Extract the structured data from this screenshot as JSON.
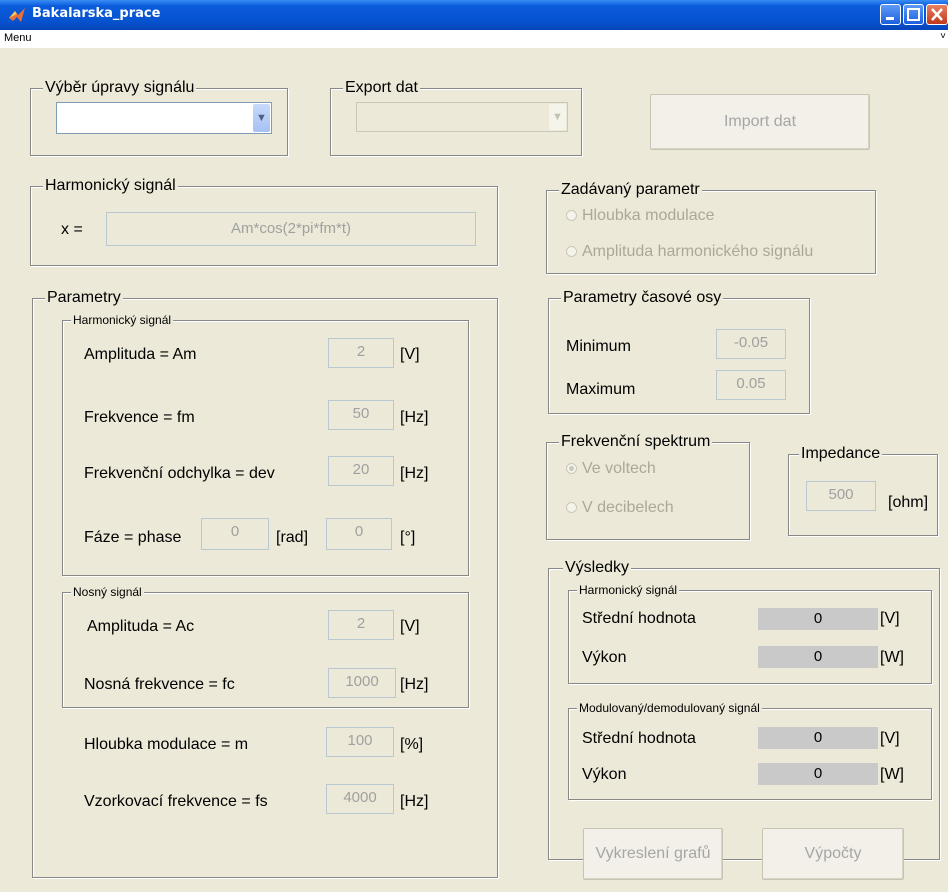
{
  "window": {
    "title": "Bakalarska_prace"
  },
  "menu": {
    "items": [
      "Menu"
    ]
  },
  "signal_select": {
    "title": "Výběr úpravy signálu",
    "value": ""
  },
  "export": {
    "title": "Export dat",
    "value": ""
  },
  "import_button": "Import dat",
  "harmonic_signal": {
    "title": "Harmonický signál",
    "x_label": "x =",
    "expression": "Am*cos(2*pi*fm*t)"
  },
  "param_select": {
    "title": "Zadávaný parametr",
    "options": [
      "Hloubka modulace",
      "Amplituda harmonického signálu"
    ]
  },
  "parametry": {
    "title": "Parametry",
    "harmonic": {
      "title": "Harmonický signál",
      "amplitude": {
        "label": "Amplituda = Am",
        "value": "2",
        "unit": "[V]"
      },
      "frequency": {
        "label": "Frekvence = fm",
        "value": "50",
        "unit": "[Hz]"
      },
      "deviation": {
        "label": "Frekvenční odchylka = dev",
        "value": "20",
        "unit": "[Hz]"
      },
      "phase": {
        "label": "Fáze = phase",
        "rad_value": "0",
        "rad_unit": "[rad]",
        "deg_value": "0",
        "deg_unit": "[°]"
      }
    },
    "carrier": {
      "title": "Nosný signál",
      "amplitude": {
        "label": "Amplituda = Ac",
        "value": "2",
        "unit": "[V]"
      },
      "frequency": {
        "label": "Nosná frekvence = fc",
        "value": "1000",
        "unit": "[Hz]"
      }
    },
    "modulation_depth": {
      "label": "Hloubka modulace = m",
      "value": "100",
      "unit": "[%]"
    },
    "sampling": {
      "label": "Vzorkovací frekvence = fs",
      "value": "4000",
      "unit": "[Hz]"
    }
  },
  "time_axis": {
    "title": "Parametry časové osy",
    "min_label": "Minimum",
    "min_value": "-0.05",
    "max_label": "Maximum",
    "max_value": "0.05"
  },
  "spectrum": {
    "title": "Frekvenční spektrum",
    "options": [
      "Ve voltech",
      "V decibelech"
    ],
    "selected": 0
  },
  "impedance": {
    "title": "Impedance",
    "value": "500",
    "unit": "[ohm]"
  },
  "results": {
    "title": "Výsledky",
    "harmonic": {
      "title": "Harmonický signál",
      "mean_label": "Střední hodnota",
      "mean_value": "0",
      "mean_unit": "[V]",
      "power_label": "Výkon",
      "power_value": "0",
      "power_unit": "[W]"
    },
    "modulated": {
      "title": "Modulovaný/demodulovaný signál",
      "mean_label": "Střední hodnota",
      "mean_value": "0",
      "mean_unit": "[V]",
      "power_label": "Výkon",
      "power_value": "0",
      "power_unit": "[W]"
    }
  },
  "buttons": {
    "plot": "Vykreslení grafů",
    "compute": "Výpočty"
  }
}
